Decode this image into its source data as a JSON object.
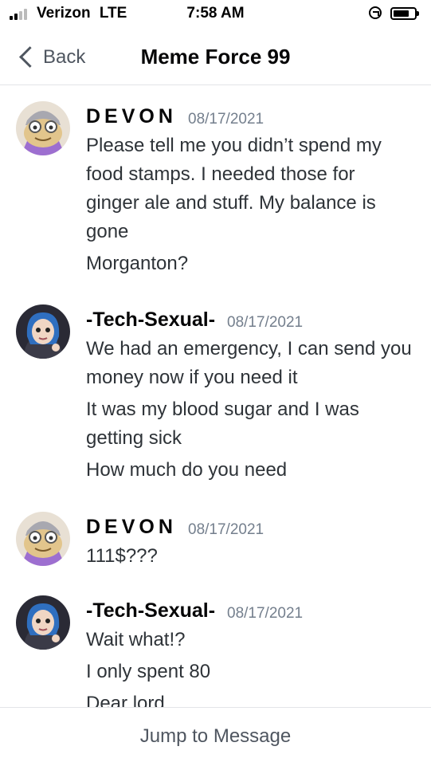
{
  "status_bar": {
    "carrier": "Verizon",
    "network": "LTE",
    "time": "7:58 AM"
  },
  "header": {
    "back_label": "Back",
    "title": "Meme Force 99"
  },
  "messages": [
    {
      "author": "DEVON",
      "timestamp": "08/17/2021",
      "lines": [
        "Please tell me you didn’t spend my food stamps. I needed those for ginger ale and stuff. My balance is gone",
        "Morganton?"
      ]
    },
    {
      "author": "-Tech-Sexual-",
      "timestamp": "08/17/2021",
      "lines": [
        "We had an emergency, I can send you money now if you need it",
        "It was my blood sugar and I was getting sick",
        "How much do you need"
      ]
    },
    {
      "author": "DEVON",
      "timestamp": "08/17/2021",
      "lines": [
        "111$???"
      ]
    },
    {
      "author": "-Tech-Sexual-",
      "timestamp": "08/17/2021",
      "lines": [
        "Wait what!?",
        "I only spent 80",
        "Dear lord"
      ]
    }
  ],
  "footer": {
    "jump_label": "Jump to Message"
  }
}
